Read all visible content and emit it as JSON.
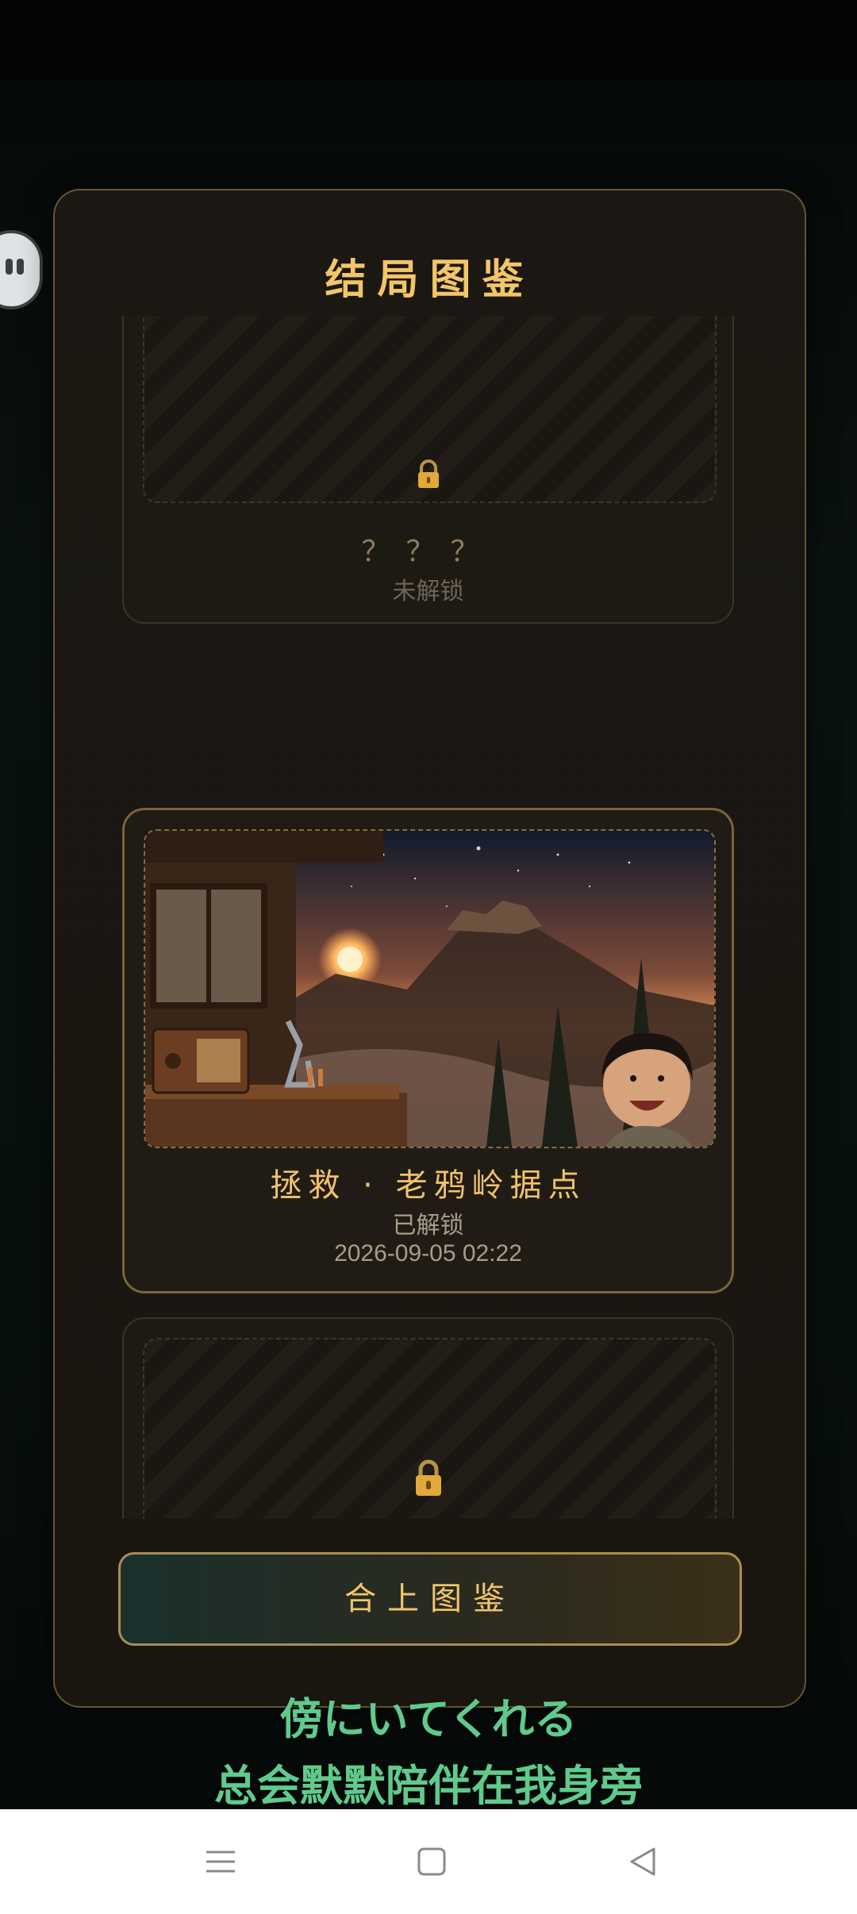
{
  "modal": {
    "title": "结局图鉴",
    "close_label": "合上图鉴"
  },
  "endings": [
    {
      "title": "？？？",
      "status": "未解锁",
      "locked": true
    },
    {
      "title": "拯救 · 老鸦岭据点",
      "status": "已解锁",
      "date": "2026-09-05 02:22",
      "locked": false
    },
    {
      "title": "？？？",
      "locked": true
    }
  ],
  "subtitles": {
    "line1": "傍にいてくれる",
    "line2": "总会默默陪伴在我身旁"
  },
  "icons": {
    "lock": "lock-icon",
    "side": "chat-bubble-icon",
    "nav_menu": "menu-icon",
    "nav_home": "home-square-icon",
    "nav_back": "back-triangle-icon"
  },
  "colors": {
    "accent_gold": "#f3c569",
    "subtitle_green": "#5fca8c"
  }
}
